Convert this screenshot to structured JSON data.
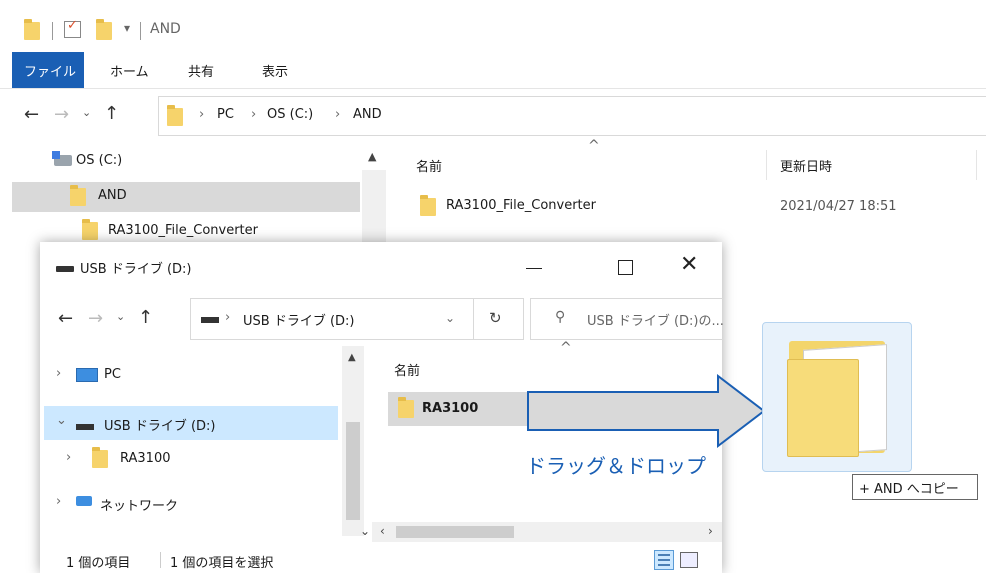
{
  "bg_window": {
    "title": "AND",
    "ribbon_tabs": [
      "ファイル",
      "ホーム",
      "共有",
      "表示"
    ],
    "breadcrumb": [
      "PC",
      "OS (C:)",
      "AND"
    ],
    "nav_items": [
      {
        "label": "OS (C:)",
        "icon": "drive-icon"
      },
      {
        "label": "AND",
        "icon": "folder-icon"
      },
      {
        "label": "RA3100_File_Converter",
        "icon": "folder-icon"
      }
    ],
    "columns": [
      "名前",
      "更新日時"
    ],
    "files": [
      {
        "name": "RA3100_File_Converter",
        "modified": "2021/04/27 18:51"
      }
    ]
  },
  "fg_window": {
    "title": "USB ドライブ (D:)",
    "address": "USB ドライブ (D:)",
    "search_placeholder": "USB ドライブ (D:)の...",
    "nav_items": [
      {
        "label": "PC",
        "icon": "computer-icon"
      },
      {
        "label": "USB ドライブ (D:)",
        "icon": "usb-drive-icon"
      },
      {
        "label": "RA3100",
        "icon": "folder-icon"
      },
      {
        "label": "ネットワーク",
        "icon": "network-icon"
      }
    ],
    "column": "名前",
    "files": [
      {
        "name": "RA3100"
      }
    ],
    "status_count": "1 個の項目",
    "status_selected": "1 個の項目を選択"
  },
  "annotation": {
    "drag_label": "ドラッグ＆ドロップ",
    "copy_tooltip": "+ AND へコピー"
  },
  "colors": {
    "accent": "#1a5fb4",
    "folder": "#f6d36b",
    "selection": "#cce8ff",
    "highlight": "#d9d9d9"
  }
}
